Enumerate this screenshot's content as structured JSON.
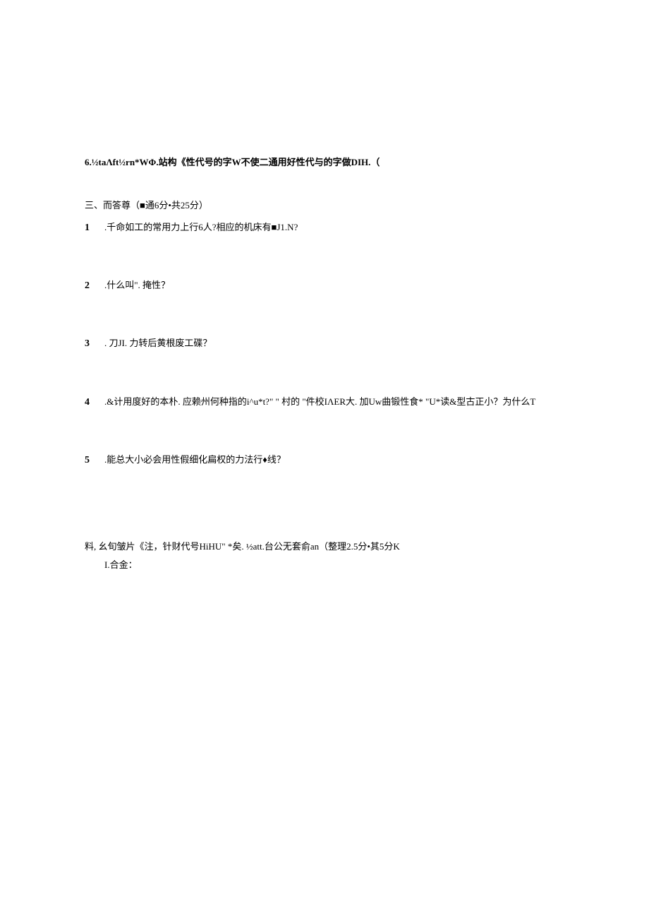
{
  "item6": "6.½taΛft½rn*WΦ.站构《性代号的字W不使二通用好性代与的字做DIH.（",
  "section3_header": "三、而答尊（■通6分•共25分）",
  "q1_num": "1",
  "q1_text": " .千命如工的常用力上行6人?相应的机床有■J1.N?",
  "q2_num": "2",
  "q2_text": " .什么叫\". 掩性？",
  "q3_num": "3",
  "q3_text": " . 刀JI. 力转后黄根废工碟？",
  "q4_num": "4",
  "q4_text": " .&计用度好的本朴. 应赖州何种指的i^u*t?\" \" 村的 \"件校IΛER大. 加Uw曲锻性食* \"U*读&型古正小？为什么T",
  "q5_num": "5",
  "q5_text": " .能总大小必会用性假细化扁权的力法行♦线？",
  "final_line1": "料, 幺旬皱片《注，针财代号HiHU\" *矣. ½att.台公无套俞an（整理2.5分•其5分K",
  "final_line2": "I.合金："
}
